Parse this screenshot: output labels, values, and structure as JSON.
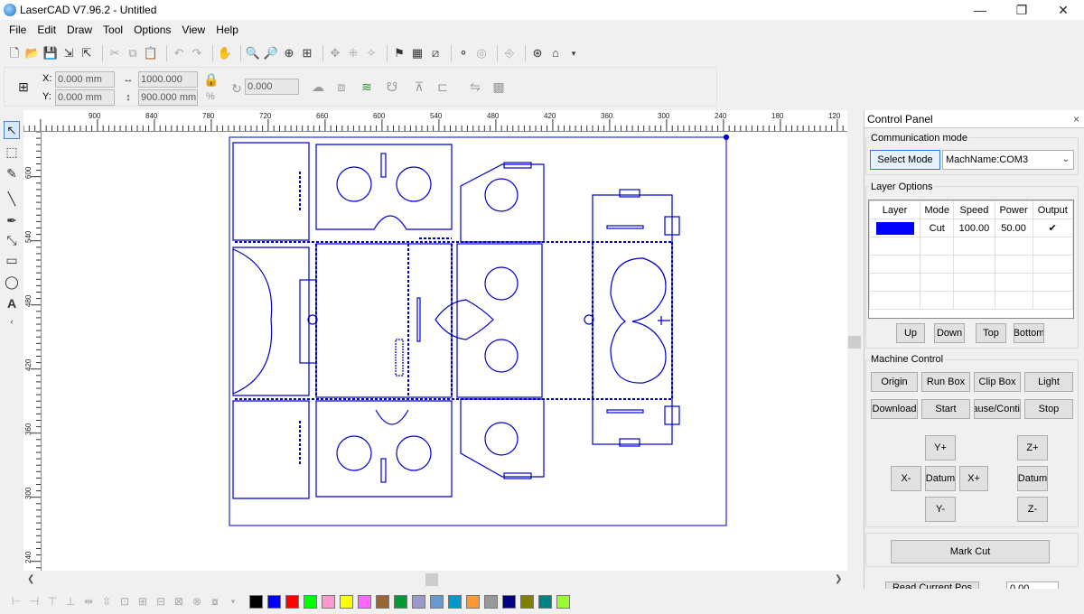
{
  "window": {
    "title": "LaserCAD V7.96.2 - Untitled",
    "minimize": "—",
    "maximize": "❐",
    "close": "✕"
  },
  "menu": [
    "File",
    "Edit",
    "Draw",
    "Tool",
    "Options",
    "View",
    "Help"
  ],
  "coords": {
    "x_label": "X:",
    "x_value": "0.000 mm",
    "y_label": "Y:",
    "y_value": "0.000 mm",
    "width_value": "1000.000 mm",
    "height_value": "900.000 mm",
    "rotate_value": "0.000",
    "percent_symbol": "%"
  },
  "ruler": {
    "top_labels": [
      "900",
      "840",
      "780",
      "720",
      "660",
      "600",
      "540",
      "480",
      "420",
      "360",
      "300",
      "240",
      "180",
      "120"
    ],
    "left_labels": [
      "600",
      "540",
      "480",
      "420",
      "360",
      "300",
      "240"
    ]
  },
  "panel": {
    "title": "Control Panel",
    "close": "×",
    "communication_mode": {
      "title": "Communication mode",
      "select_mode_button": "Select Mode",
      "machine_select": "MachName:COM3"
    },
    "layer_options": {
      "title": "Layer Options",
      "headers": [
        "Layer",
        "Mode",
        "Speed",
        "Power",
        "Output"
      ],
      "rows": [
        {
          "color": "#0000ff",
          "mode": "Cut",
          "speed": "100.00",
          "power": "50.00",
          "output": "✔"
        }
      ],
      "buttons": [
        "Up",
        "Down",
        "Top",
        "Bottom"
      ]
    },
    "machine_control": {
      "title": "Machine Control",
      "row1": [
        "Origin",
        "Run Box",
        "Clip Box",
        "Light"
      ],
      "row2": [
        "Download",
        "Start",
        "Pause/Continue",
        "Stop"
      ],
      "jog": {
        "y_plus": "Y+",
        "x_minus": "X-",
        "datum": "Datum",
        "x_plus": "X+",
        "y_minus": "Y-",
        "z_plus": "Z+",
        "z_datum": "Datum",
        "z_minus": "Z-"
      },
      "mark_cut": "Mark Cut",
      "partial_button": "Read Current Pos",
      "partial_input": "0.00"
    }
  },
  "palette": [
    "#000000",
    "#0000ff",
    "#ff0000",
    "#00ff00",
    "#ff99cc",
    "#ffff00",
    "#ff66ff",
    "#996633",
    "#009933",
    "#9999cc",
    "#6699cc",
    "#0099cc",
    "#ff9933",
    "#999999",
    "#000080",
    "#808000",
    "#008080",
    "#99ff33"
  ]
}
